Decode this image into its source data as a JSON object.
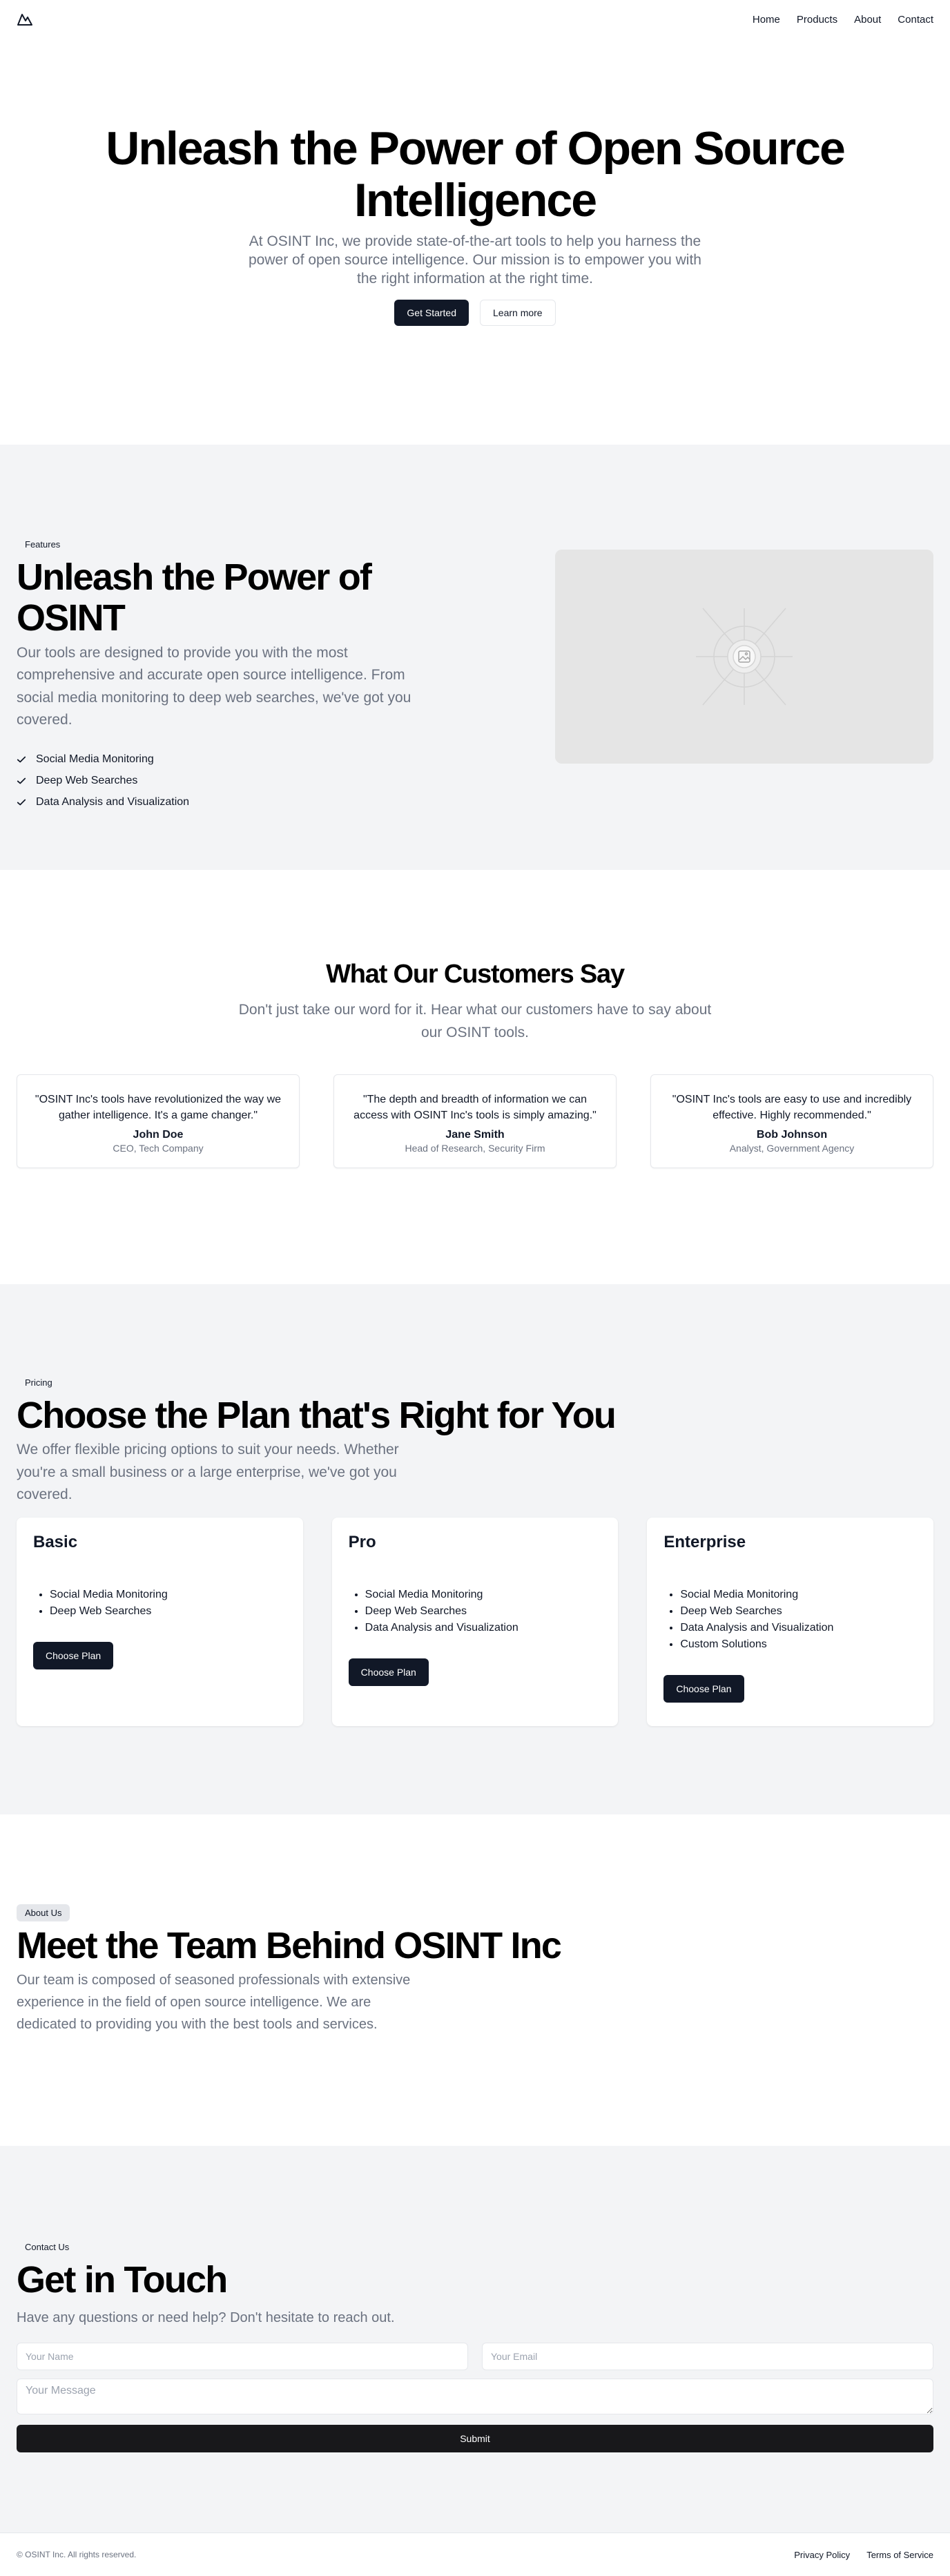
{
  "header": {
    "logo_icon": "mountain-icon",
    "nav": [
      "Home",
      "Products",
      "About",
      "Contact"
    ]
  },
  "hero": {
    "title": "Unleash the Power of Open Source Intelligence",
    "subtitle": "At OSINT Inc, we provide state-of-the-art tools to help you harness the power of open source intelligence. Our mission is to empower you with the right information at the right time.",
    "primary_button": "Get Started",
    "secondary_button": "Learn more"
  },
  "features": {
    "tag": "Features",
    "title": "Unleash the Power of OSINT",
    "subtitle": "Our tools are designed to provide you with the most comprehensive and accurate open source intelligence. From social media monitoring to deep web searches, we've got you covered.",
    "items": [
      "Social Media Monitoring",
      "Deep Web Searches",
      "Data Analysis and Visualization"
    ],
    "image_icon": "image-placeholder-icon"
  },
  "testimonials": {
    "title": "What Our Customers Say",
    "subtitle": "Don't just take our word for it. Hear what our customers have to say about our OSINT tools.",
    "items": [
      {
        "quote": "\"OSINT Inc's tools have revolutionized the way we gather intelligence. It's a game changer.\"",
        "name": "John Doe",
        "role": "CEO, Tech Company"
      },
      {
        "quote": "\"The depth and breadth of information we can access with OSINT Inc's tools is simply amazing.\"",
        "name": "Jane Smith",
        "role": "Head of Research, Security Firm"
      },
      {
        "quote": "\"OSINT Inc's tools are easy to use and incredibly effective. Highly recommended.\"",
        "name": "Bob Johnson",
        "role": "Analyst, Government Agency"
      }
    ]
  },
  "pricing": {
    "tag": "Pricing",
    "title": "Choose the Plan that's Right for You",
    "subtitle": "We offer flexible pricing options to suit your needs. Whether you're a small business or a large enterprise, we've got you covered.",
    "plans": [
      {
        "name": "Basic",
        "features": [
          "Social Media Monitoring",
          "Deep Web Searches"
        ],
        "button": "Choose Plan"
      },
      {
        "name": "Pro",
        "features": [
          "Social Media Monitoring",
          "Deep Web Searches",
          "Data Analysis and Visualization"
        ],
        "button": "Choose Plan"
      },
      {
        "name": "Enterprise",
        "features": [
          "Social Media Monitoring",
          "Deep Web Searches",
          "Data Analysis and Visualization",
          "Custom Solutions"
        ],
        "button": "Choose Plan"
      }
    ]
  },
  "about": {
    "tag": "About Us",
    "title": "Meet the Team Behind OSINT Inc",
    "subtitle": "Our team is composed of seasoned professionals with extensive experience in the field of open source intelligence. We are dedicated to providing you with the best tools and services."
  },
  "contact": {
    "tag": "Contact Us",
    "title": "Get in Touch",
    "subtitle": "Have any questions or need help? Don't hesitate to reach out.",
    "name_placeholder": "Your Name",
    "email_placeholder": "Your Email",
    "message_placeholder": "Your Message",
    "submit": "Submit"
  },
  "footer": {
    "copyright": "© OSINT Inc. All rights reserved.",
    "links": [
      "Privacy Policy",
      "Terms of Service"
    ]
  }
}
